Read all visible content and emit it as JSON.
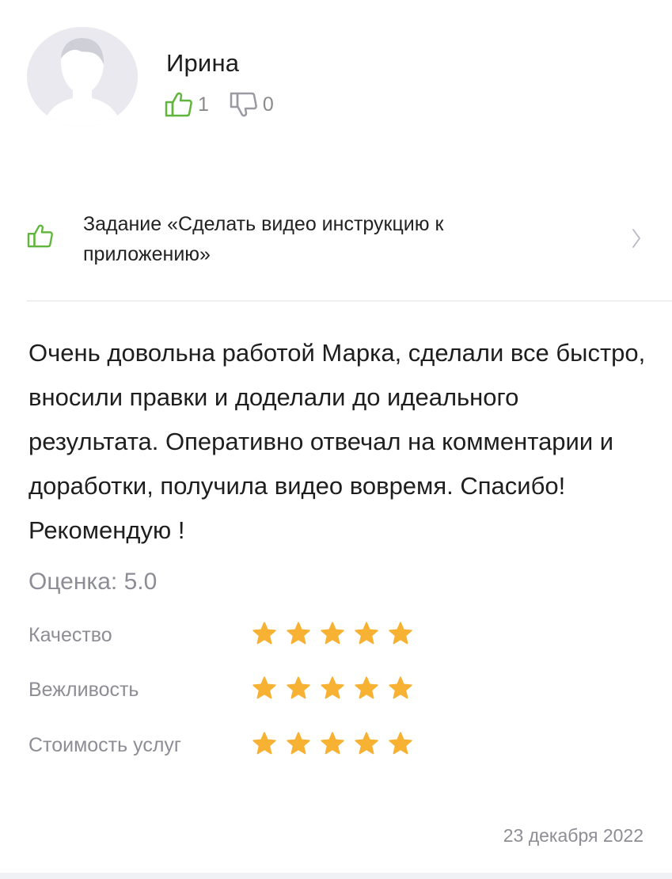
{
  "review": {
    "author": {
      "name": "Ирина",
      "avatar_icon": "user-silhouette-icon"
    },
    "votes": {
      "likes": "1",
      "dislikes": "0",
      "like_icon": "thumbs-up-icon",
      "dislike_icon": "thumbs-down-icon",
      "like_color": "#5fb63a"
    },
    "task": {
      "icon": "thumbs-up-icon",
      "title": "Задание «Сделать видео инструкцию к приложению»",
      "chevron_icon": "chevron-right-icon"
    },
    "text": "Очень довольна работой Марка, сделали все быстро, вносили правки и доделали до идеального результата. Оперативно отвечал на комментарии и доработки, получила видео вовремя. Спасибо! Рекомендую !",
    "rating": {
      "summary": "Оценка: 5.0",
      "categories": [
        {
          "label": "Качество",
          "stars": 5
        },
        {
          "label": "Вежливость",
          "stars": 5
        },
        {
          "label": "Стоимость услуг",
          "stars": 5
        }
      ],
      "max_stars": 5,
      "star_color": "#f7b133"
    },
    "date": "23 декабря 2022"
  }
}
